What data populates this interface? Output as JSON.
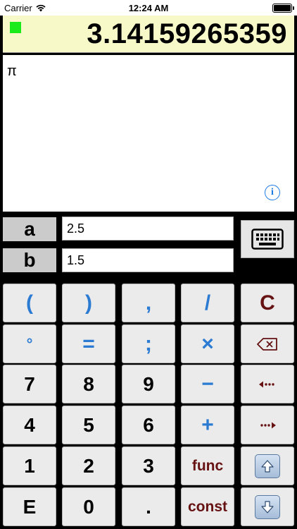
{
  "status_bar": {
    "carrier": "Carrier",
    "time": "12:24 AM"
  },
  "display": {
    "value": "3.14159265359",
    "indicator_color": "#1bea1b"
  },
  "expression": {
    "text": "π",
    "info_label": "i"
  },
  "variables": [
    {
      "name": "a",
      "value": "2.5"
    },
    {
      "name": "b",
      "value": "1.5"
    }
  ],
  "keypad": {
    "rows": [
      [
        "(",
        ")",
        ",",
        "/",
        "C"
      ],
      [
        "°",
        "=",
        ";",
        "×",
        "backspace"
      ],
      [
        "7",
        "8",
        "9",
        "−",
        "cursor-left"
      ],
      [
        "4",
        "5",
        "6",
        "+",
        "cursor-right"
      ],
      [
        "1",
        "2",
        "3",
        "func",
        "up"
      ],
      [
        "E",
        "0",
        ".",
        "const",
        "down"
      ]
    ]
  },
  "colors": {
    "accent_blue": "#2a7bd1",
    "accent_red": "#661212",
    "display_bg": "#f7f9c8"
  }
}
